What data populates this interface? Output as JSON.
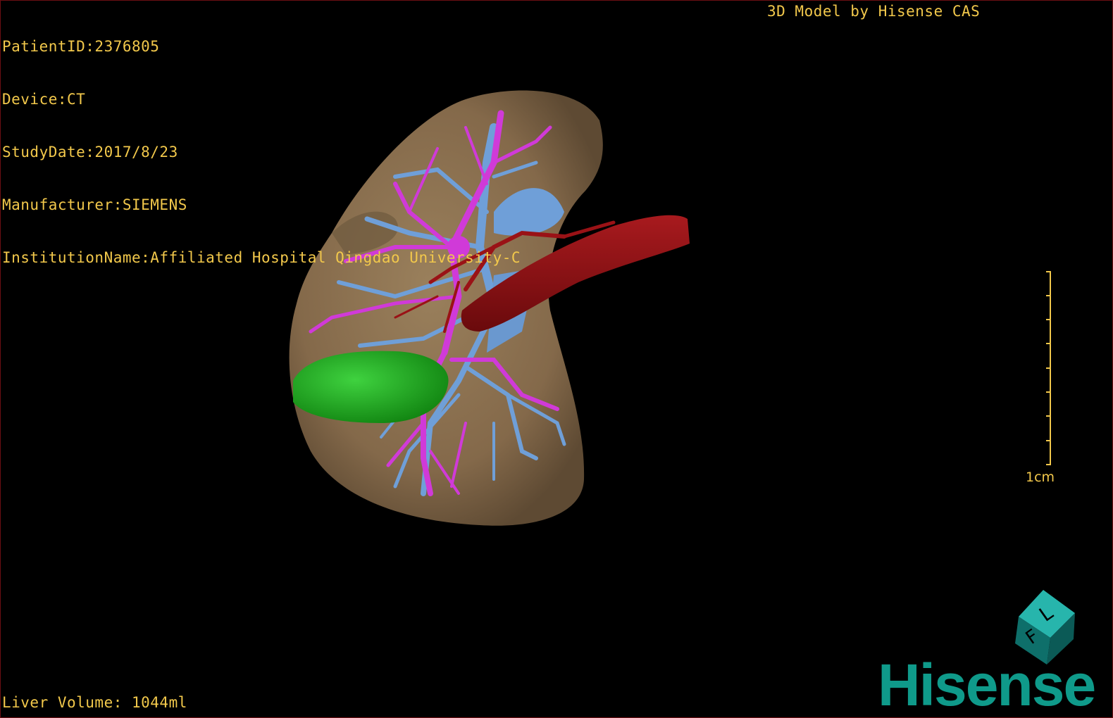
{
  "patient_info": {
    "patient_id": "PatientID:2376805",
    "device": "Device:CT",
    "study_date": "StudyDate:2017/8/23",
    "manufacturer": "Manufacturer:SIEMENS",
    "institution": "InstitutionName:Affiliated Hospital Qingdao University-C"
  },
  "brand_credit": "3D Model by Hisense CAS",
  "liver_volume": "Liver Volume: 1044ml",
  "scale": {
    "label": "1cm"
  },
  "orientation_cube": {
    "face_left": "F",
    "face_right": "L"
  },
  "logo": {
    "text": "Hisense"
  },
  "colors": {
    "overlay_text": "#f2c84b",
    "liver": "#8a7050",
    "portal_vein": "#d03ad8",
    "hepatic_vein": "#6f9fd8",
    "artery": "#8c1014",
    "gallbladder": "#20b020",
    "brand": "#0f9a8a"
  }
}
